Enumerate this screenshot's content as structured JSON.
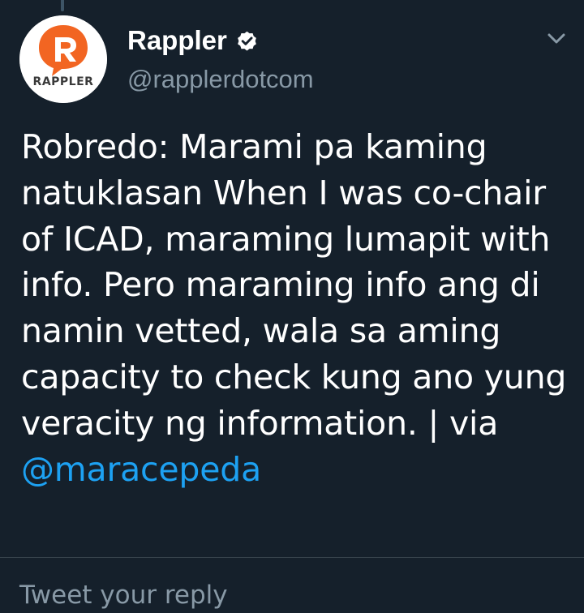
{
  "account": {
    "display_name": "Rappler",
    "handle": "@rapplerdotcom",
    "avatar_wordmark": "RAPPLER",
    "verified_icon": "verified-badge-icon",
    "menu_icon": "chevron-down-icon"
  },
  "tweet": {
    "text": "Robredo: Marami pa kaming natuklasan When I was co-chair of ICAD, maraming lumapit with info. Pero maraming info ang di namin vetted, wala sa aming capacity to check kung ano yung veracity ng information. | via ",
    "mention": "@maracepeda"
  },
  "reply": {
    "placeholder": "Tweet your reply"
  },
  "colors": {
    "background": "#15202b",
    "text": "#ffffff",
    "secondary_text": "#8899a6",
    "link": "#1da1f2",
    "brand_orange": "#f26522"
  }
}
